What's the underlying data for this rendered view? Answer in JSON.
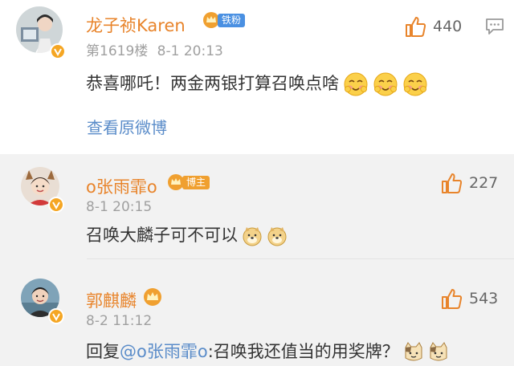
{
  "main_comment": {
    "username": "龙子祯Karen",
    "badge": "铁粉",
    "floor": "第1619楼",
    "date": "8-1 20:13",
    "text": "恭喜哪吒！两金两银打算召唤点啥",
    "likes": "440",
    "view_original": "查看原微博"
  },
  "replies": [
    {
      "username": "o张雨霏o",
      "badge": "博主",
      "date": "8-1 20:15",
      "text": "召唤大麟子可不可以",
      "likes": "227"
    },
    {
      "username": "郭麒麟",
      "date": "8-2 11:12",
      "reply_prefix": "回复",
      "mention": "@o张雨霏o",
      "text": ":召唤我还值当的用奖牌？",
      "likes": "543"
    }
  ],
  "colors": {
    "username": "#e8842b",
    "link": "#5a8cc9",
    "badge_blue": "#4a90e2",
    "badge_orange": "#f0a030",
    "verified": "#f5a623"
  },
  "icons": {
    "like": "thumbs-up-icon",
    "more": "comment-more-icon",
    "emoji_main": "blush-face-emoji",
    "emoji_reply": "doge-emoji",
    "emoji_reply2": "cat-emoji"
  }
}
